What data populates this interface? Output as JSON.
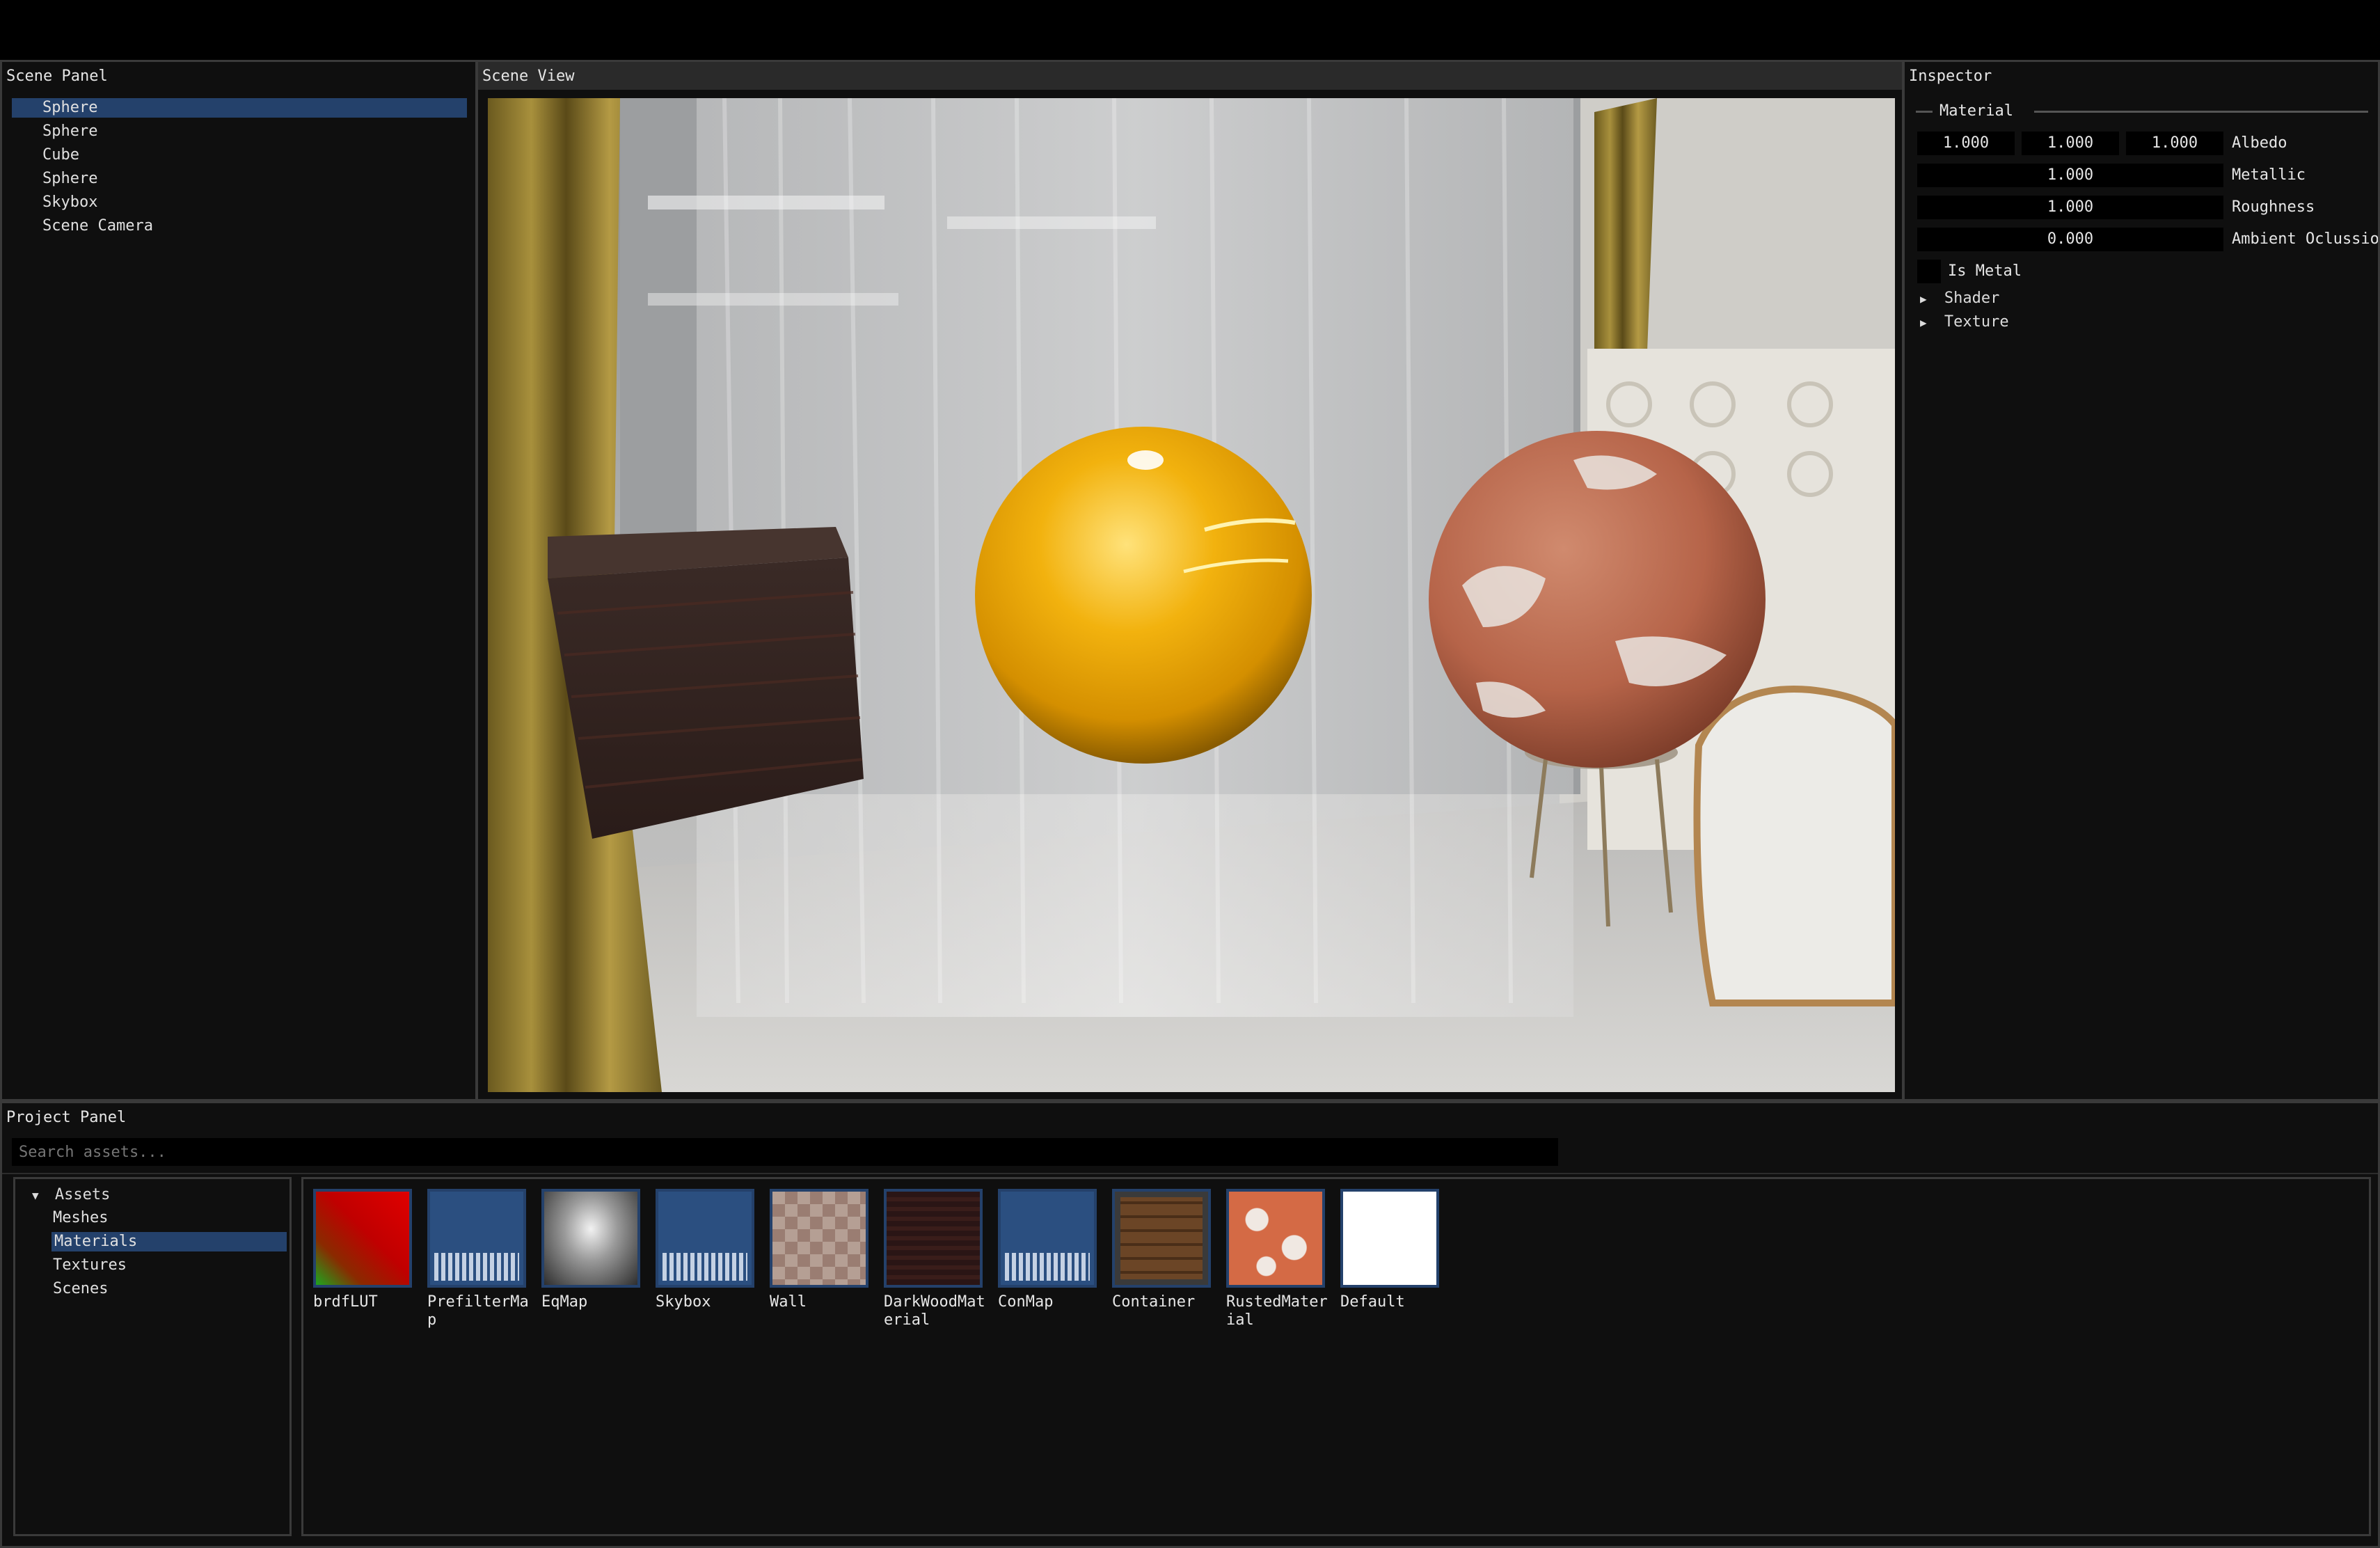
{
  "scene_panel": {
    "title": "Scene Panel",
    "items": [
      "Sphere",
      "Sphere",
      "Cube",
      "Sphere",
      "Skybox",
      "Scene Camera"
    ],
    "selected_index": 0
  },
  "scene_view": {
    "title": "Scene View"
  },
  "inspector": {
    "title": "Inspector",
    "section": "Material",
    "albedo": {
      "r": "1.000",
      "g": "1.000",
      "b": "1.000",
      "label": "Albedo"
    },
    "metallic": {
      "value": "1.000",
      "label": "Metallic"
    },
    "roughness": {
      "value": "1.000",
      "label": "Roughness"
    },
    "ambient_occlusion": {
      "value": "0.000",
      "label": "Ambient Oclussion"
    },
    "is_metal_label": "Is Metal",
    "shader_label": "Shader",
    "texture_label": "Texture",
    "arrow": "▶"
  },
  "project_panel": {
    "title": "Project Panel",
    "search_placeholder": "Search assets...",
    "tree": {
      "root": "Assets",
      "root_arrow": "▼",
      "children": [
        "Meshes",
        "Materials",
        "Textures",
        "Scenes"
      ],
      "selected_index": 1
    },
    "assets": [
      {
        "name": "brdfLUT",
        "icon": "brdf-lut-thumbnail"
      },
      {
        "name": "PrefilterMap",
        "icon": "cubemap-thumbnail"
      },
      {
        "name": "EqMap",
        "icon": "equirect-map-thumbnail"
      },
      {
        "name": "Skybox",
        "icon": "cubemap-thumbnail"
      },
      {
        "name": "Wall",
        "icon": "wall-texture-thumbnail"
      },
      {
        "name": "DarkWoodMaterial",
        "icon": "dark-wood-thumbnail"
      },
      {
        "name": "ConMap",
        "icon": "cubemap-thumbnail"
      },
      {
        "name": "Container",
        "icon": "container-thumbnail"
      },
      {
        "name": "RustedMaterial",
        "icon": "rusted-thumbnail"
      },
      {
        "name": "Default",
        "icon": "default-white-thumbnail"
      }
    ]
  },
  "colors": {
    "selection": "#24416b",
    "panel_bg": "#0f0f0f",
    "title_bar": "#2a2a2a",
    "border": "#3a3a3a"
  }
}
